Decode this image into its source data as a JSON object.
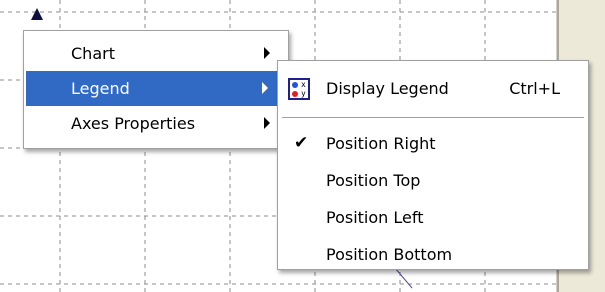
{
  "context_menu": {
    "items": [
      {
        "label": "Chart",
        "has_submenu": true,
        "selected": false
      },
      {
        "label": "Legend",
        "has_submenu": true,
        "selected": true
      },
      {
        "label": "Axes Properties",
        "has_submenu": true,
        "selected": false
      }
    ]
  },
  "legend_submenu": {
    "display_legend": {
      "label": "Display Legend",
      "shortcut": "Ctrl+L",
      "icon": "legend-icon"
    },
    "positions": [
      {
        "label": "Position Right",
        "checked": true
      },
      {
        "label": "Position Top",
        "checked": false
      },
      {
        "label": "Position Left",
        "checked": false
      },
      {
        "label": "Position Bottom",
        "checked": false
      }
    ],
    "check_glyph": "✔"
  },
  "colors": {
    "selection": "#316ac5",
    "grid": "#8c8c8c",
    "panel": "#ece9d8"
  }
}
